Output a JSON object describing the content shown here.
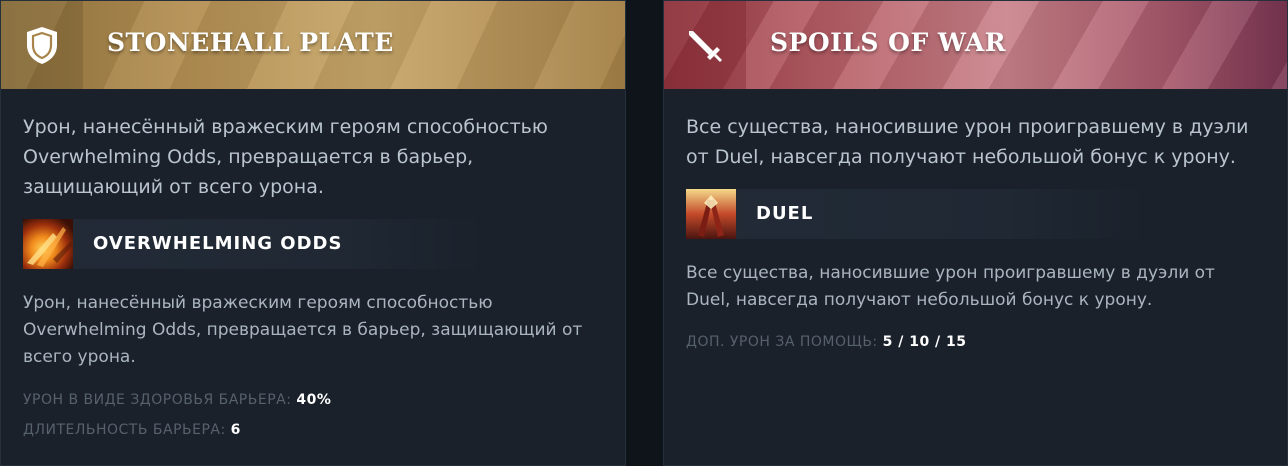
{
  "left": {
    "title": "STONEHALL PLATE",
    "icon": "shield-icon",
    "description": "Урон, нанесённый вражеским героям способностью Overwhelming Odds, превращается в барьер, защищающий от всего урона.",
    "ability": {
      "name": "OVERWHELMING ODDS",
      "icon": "overwhelming-odds-ability-icon",
      "description": "Урон, нанесённый вражеским героям способностью Overwhelming Odds, превращается в барьер, защищающий от всего урона."
    },
    "stats": [
      {
        "label": "УРОН В ВИДЕ ЗДОРОВЬЯ БАРЬЕРА:",
        "value": "40%"
      },
      {
        "label": "ДЛИТЕЛЬНОСТЬ БАРЬЕРА:",
        "value": "6"
      }
    ],
    "accent": "#b89458"
  },
  "right": {
    "title": "SPOILS OF WAR",
    "icon": "sword-icon",
    "description": "Все существа, наносившие урон проигравшему в дуэли от Duel, навсегда получают небольшой бонус к урону.",
    "ability": {
      "name": "DUEL",
      "icon": "duel-ability-icon",
      "description": "Все существа, наносившие урон проигравшему в дуэли от Duel, навсегда получают небольшой бонус к урону."
    },
    "stats": [
      {
        "label": "ДОП. УРОН ЗА ПОМОЩЬ:",
        "value": "5 / 10 / 15"
      }
    ],
    "accent": "#b9656e"
  }
}
